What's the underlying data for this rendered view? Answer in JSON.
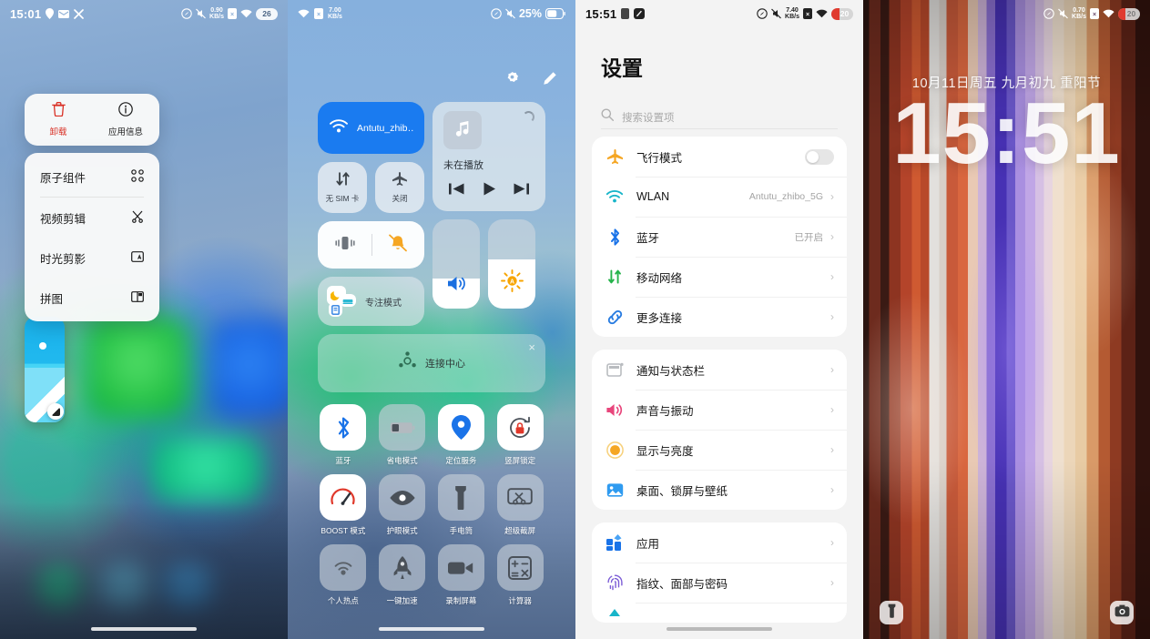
{
  "panels": {
    "home_menu": {
      "statusbar": {
        "time": "15:01",
        "left_icons": [
          "location-icon",
          "mail-icon",
          "tools-icon"
        ],
        "net_speed_value": "0.90",
        "net_speed_unit": "KB/s",
        "right_icons": [
          "compass-icon",
          "mute-icon",
          "sim-x-icon",
          "wifi-icon"
        ],
        "battery": "26"
      },
      "quick_actions": [
        {
          "label": "卸载",
          "icon": "trash-icon",
          "color": "#d93025"
        },
        {
          "label": "应用信息",
          "icon": "info-icon",
          "color": "#1b1b1b"
        }
      ],
      "menu_items": [
        {
          "label": "原子组件",
          "icon": "atomic-widget-icon"
        },
        {
          "label": "视频剪辑",
          "icon": "scissors-icon"
        },
        {
          "label": "时光剪影",
          "icon": "photo-ai-icon"
        },
        {
          "label": "拼图",
          "icon": "collage-icon"
        }
      ]
    },
    "control_center": {
      "statusbar": {
        "left_icons": [
          "wifi-icon",
          "sim-x-icon"
        ],
        "net_speed_value": "7.00",
        "net_speed_unit": "KB/s",
        "right_icons": [
          "compass-icon",
          "mute-icon"
        ],
        "battery_percent": "25%"
      },
      "header_icons": [
        "gear-icon",
        "edit-pencil-icon"
      ],
      "wifi_tile": {
        "label": "Antutu_zhib…",
        "icon": "wifi-icon",
        "active_color": "#1a7bf0"
      },
      "mini_tiles": [
        {
          "label": "无 SIM 卡",
          "icon": "mobile-data-icon"
        },
        {
          "label": "关闭",
          "icon": "airplane-icon"
        }
      ],
      "sound_tiles": [
        {
          "icon": "vibrate-icon"
        },
        {
          "icon": "bell-off-icon"
        }
      ],
      "focus_tile": {
        "label": "专注模式",
        "icons": [
          "moon-icon",
          "bed-icon",
          "book-icon"
        ]
      },
      "media": {
        "title": "未在播放",
        "art_icon": "music-note-icon",
        "controls": [
          "prev-icon",
          "play-icon",
          "next-icon"
        ],
        "loading": true
      },
      "sliders": [
        {
          "name": "volume",
          "icon": "speaker-icon",
          "value": 34
        },
        {
          "name": "brightness",
          "icon": "sun-icon",
          "value": 55
        }
      ],
      "connect_center": {
        "label": "连接中心",
        "icon": "connect-center-icon",
        "close": "×"
      },
      "toggles": [
        {
          "label": "蓝牙",
          "icon": "bluetooth-icon",
          "on": true
        },
        {
          "label": "省电模式",
          "icon": "battery-saver-icon",
          "on": false
        },
        {
          "label": "定位服务",
          "icon": "location-pin-icon",
          "on": true
        },
        {
          "label": "竖屏锁定",
          "icon": "rotation-lock-icon",
          "on": true
        },
        {
          "label": "BOOST 模式",
          "icon": "boost-gauge-icon",
          "on": true
        },
        {
          "label": "护眼模式",
          "icon": "eye-care-icon",
          "on": false
        },
        {
          "label": "手电筒",
          "icon": "flashlight-icon",
          "on": false
        },
        {
          "label": "超级截屏",
          "icon": "super-screenshot-icon",
          "on": false
        },
        {
          "label": "个人热点",
          "icon": "hotspot-icon",
          "on": false
        },
        {
          "label": "一键加速",
          "icon": "rocket-icon",
          "on": false
        },
        {
          "label": "录制屏幕",
          "icon": "screen-record-icon",
          "on": false
        },
        {
          "label": "计算器",
          "icon": "calculator-icon",
          "on": false
        }
      ]
    },
    "settings": {
      "statusbar": {
        "time": "15:51",
        "left_icons": [
          "sim-x-icon",
          "app-icon"
        ],
        "net_speed_value": "7.40",
        "net_speed_unit": "KB/s",
        "right_icons": [
          "compass-icon",
          "mute-icon",
          "sim-x-icon",
          "wifi-icon"
        ],
        "battery": "20"
      },
      "title": "设置",
      "search_placeholder": "搜索设置项",
      "groups": [
        {
          "rows": [
            {
              "label": "飞行模式",
              "icon": "airplane-icon",
              "icon_color": "#f5a623",
              "control": "toggle",
              "toggle_on": false
            },
            {
              "label": "WLAN",
              "icon": "wifi-icon",
              "icon_color": "#18b5c9",
              "value": "Antutu_zhibo_5G",
              "control": "chevron"
            },
            {
              "label": "蓝牙",
              "icon": "bluetooth-icon",
              "icon_color": "#1a73e8",
              "value": "已开启",
              "control": "chevron"
            },
            {
              "label": "移动网络",
              "icon": "mobile-data-icon",
              "icon_color": "#25b34b",
              "value": "",
              "control": "chevron"
            },
            {
              "label": "更多连接",
              "icon": "link-icon",
              "icon_color": "#2a7de1",
              "value": "",
              "control": "chevron"
            }
          ]
        },
        {
          "rows": [
            {
              "label": "通知与状态栏",
              "icon": "notification-bar-icon",
              "icon_color": "#b9bcc0",
              "value": "",
              "control": "chevron"
            },
            {
              "label": "声音与振动",
              "icon": "sound-icon",
              "icon_color": "#e8467c",
              "value": "",
              "control": "chevron"
            },
            {
              "label": "显示与亮度",
              "icon": "brightness-icon",
              "icon_color": "#f5a623",
              "value": "",
              "control": "chevron"
            },
            {
              "label": "桌面、锁屏与壁纸",
              "icon": "wallpaper-icon",
              "icon_color": "#2f9bf0",
              "value": "",
              "control": "chevron"
            }
          ]
        },
        {
          "rows": [
            {
              "label": "应用",
              "icon": "apps-icon",
              "icon_color": "#2a7de1",
              "value": "",
              "control": "chevron"
            },
            {
              "label": "指纹、面部与密码",
              "icon": "fingerprint-icon",
              "icon_color": "#7b5cd6",
              "value": "",
              "control": "chevron"
            }
          ]
        }
      ]
    },
    "lockscreen": {
      "statusbar": {
        "net_speed_value": "0.70",
        "net_speed_unit": "KB/s",
        "right_icons": [
          "compass-icon",
          "mute-icon",
          "sim-x-icon",
          "wifi-icon"
        ],
        "battery": "20"
      },
      "date": "10月11日周五 九月初九 重阳节",
      "time": "15:51",
      "shortcuts": [
        {
          "name": "flashlight",
          "icon": "flashlight-icon"
        },
        {
          "name": "camera",
          "icon": "camera-icon"
        }
      ]
    }
  },
  "colors": {
    "accent_blue": "#1a7bf0",
    "settings_bg": "#f3f3f3",
    "card_white": "#ffffff",
    "danger_red": "#d93025"
  }
}
